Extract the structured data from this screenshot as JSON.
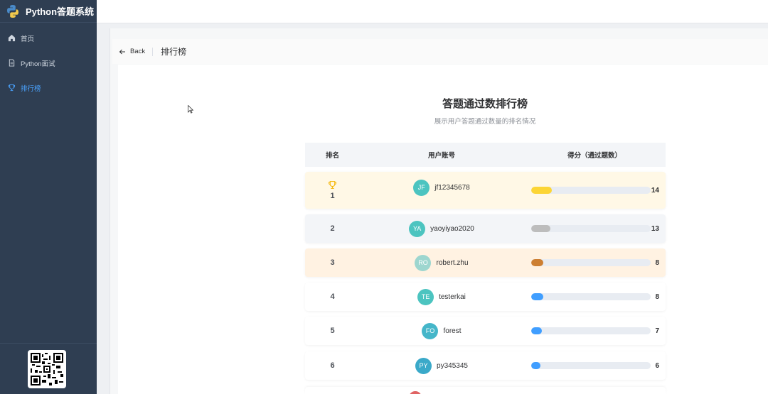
{
  "app": {
    "title": "Python答题系统"
  },
  "sidebar": {
    "items": [
      {
        "label": "首页",
        "icon": "home-icon",
        "active": false
      },
      {
        "label": "Python面试",
        "icon": "document-icon",
        "active": false
      },
      {
        "label": "排行榜",
        "icon": "trophy-icon",
        "active": true
      }
    ]
  },
  "page": {
    "back_label": "Back",
    "title": "排行榜"
  },
  "board": {
    "title": "答题通过数排行榜",
    "subtitle": "展示用户答题通过数量的排名情况",
    "columns": {
      "rank": "排名",
      "user": "用户账号",
      "score": "得分（通过题数）"
    },
    "max_score": 14,
    "rows": [
      {
        "rank": "1",
        "initials": "JF",
        "user": "jf12345678",
        "score": 14,
        "avatar_color": "#4cc4c0",
        "bar_color": "#fcd535",
        "style": "gold"
      },
      {
        "rank": "2",
        "initials": "YA",
        "user": "yaoyiyao2020",
        "score": 13,
        "avatar_color": "#4cc4c0",
        "bar_color": "#bdbdbd",
        "style": "silver"
      },
      {
        "rank": "3",
        "initials": "RO",
        "user": "robert.zhu",
        "score": 8,
        "avatar_color": "#9dd6cf",
        "bar_color": "#cd7f32",
        "style": "bronze"
      },
      {
        "rank": "4",
        "initials": "TE",
        "user": "testerkai",
        "score": 8,
        "avatar_color": "#4cc4c0",
        "bar_color": "#409eff",
        "style": "normal"
      },
      {
        "rank": "5",
        "initials": "FO",
        "user": "forest",
        "score": 7,
        "avatar_color": "#45b6c9",
        "bar_color": "#409eff",
        "style": "normal"
      },
      {
        "rank": "6",
        "initials": "PY",
        "user": "py345345",
        "score": 6,
        "avatar_color": "#3aa9c9",
        "bar_color": "#409eff",
        "style": "normal"
      }
    ]
  }
}
